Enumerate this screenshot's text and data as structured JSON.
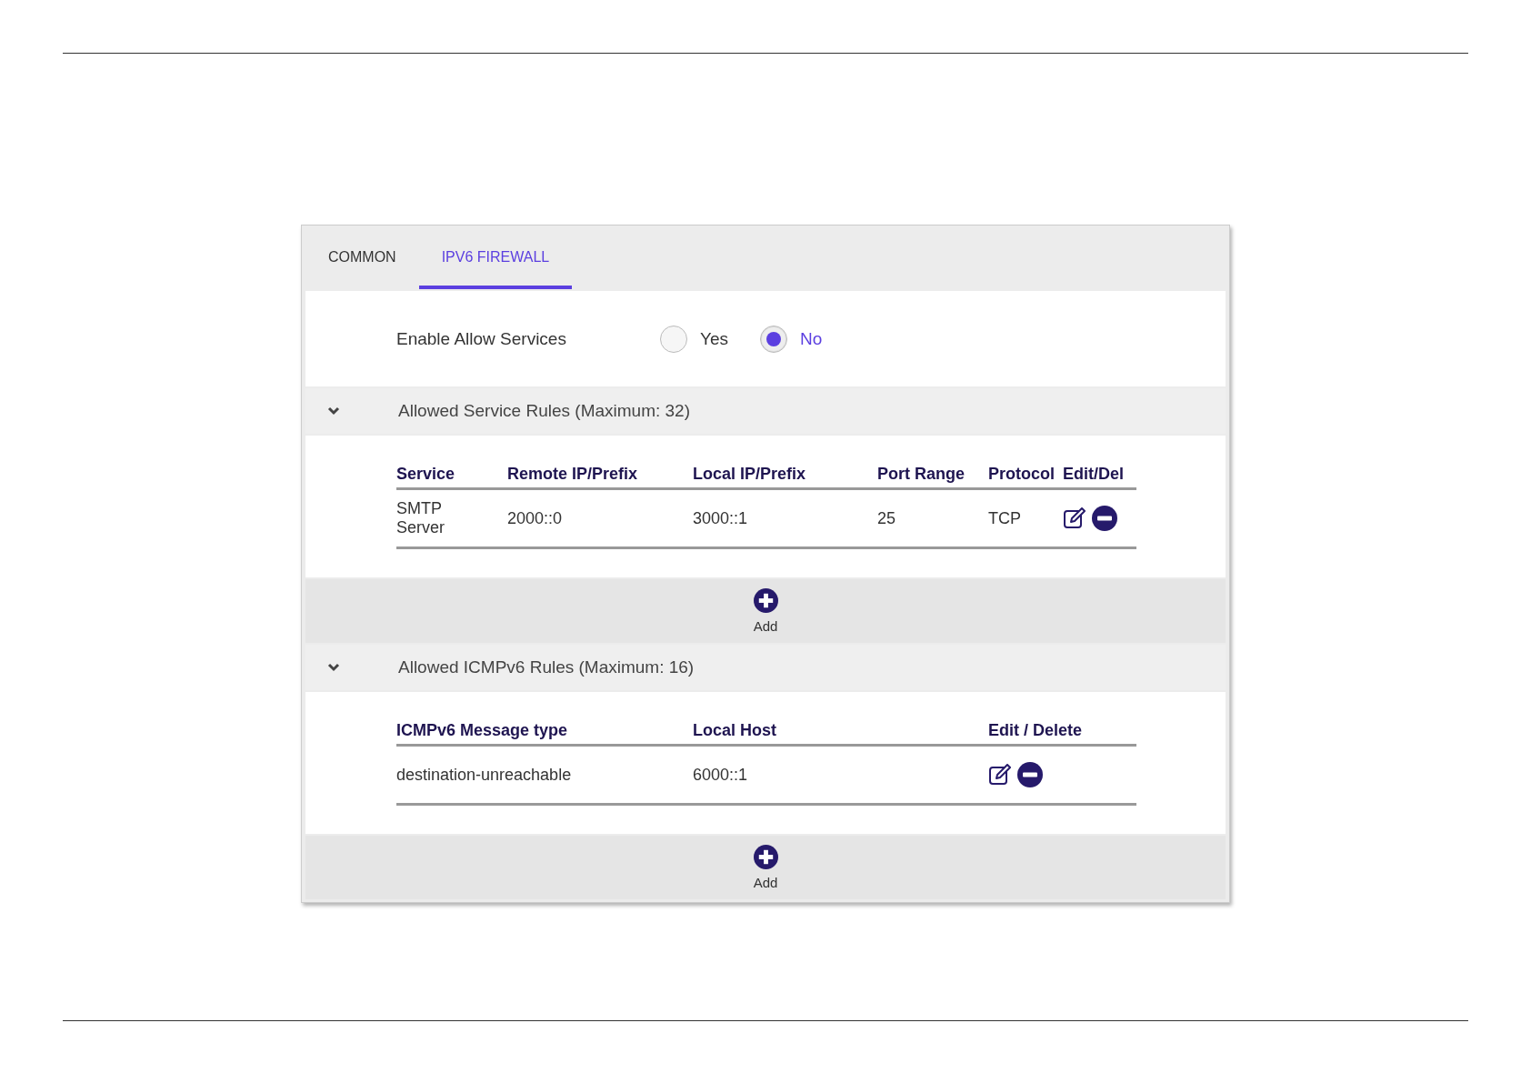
{
  "tabs": [
    {
      "label": "COMMON",
      "selected": false
    },
    {
      "label": "IPV6 FIREWALL",
      "selected": true
    }
  ],
  "enable_allow_services": {
    "label": "Enable Allow Services",
    "options": [
      {
        "label": "Yes",
        "selected": false
      },
      {
        "label": "No",
        "selected": true
      }
    ]
  },
  "sections": [
    {
      "title": "Allowed Service Rules (Maximum: 32)",
      "expanded": true,
      "columns": [
        "Service",
        "Remote IP/Prefix",
        "Local IP/Prefix",
        "Port Range",
        "Protocol",
        "Edit/Del"
      ],
      "rows": [
        {
          "cells": [
            "SMTP Server",
            "2000::0",
            "3000::1",
            "25",
            "TCP"
          ]
        }
      ],
      "add_label": "Add"
    },
    {
      "title": "Allowed ICMPv6 Rules (Maximum: 16)",
      "expanded": true,
      "columns": [
        "ICMPv6 Message type",
        "Local Host",
        "Edit / Delete"
      ],
      "rows": [
        {
          "cells": [
            "destination-unreachable",
            "6000::1"
          ]
        }
      ],
      "add_label": "Add"
    }
  ]
}
